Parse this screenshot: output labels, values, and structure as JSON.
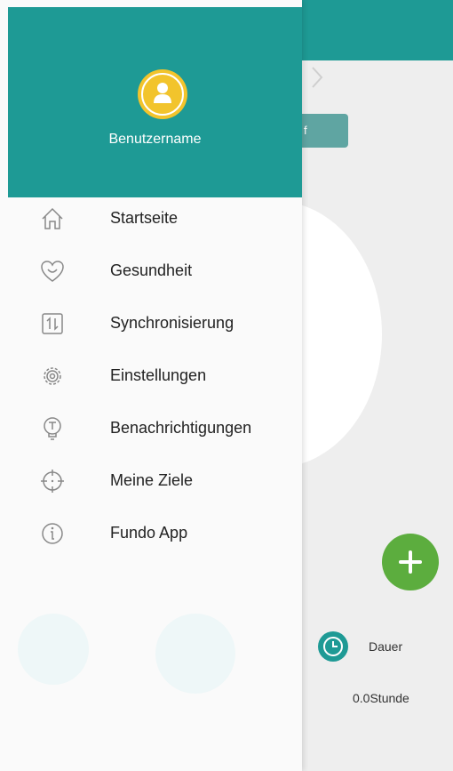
{
  "drawer": {
    "username": "Benutzername",
    "menu": [
      {
        "label": "Startseite",
        "icon": "home-icon"
      },
      {
        "label": "Gesundheit",
        "icon": "heart-smile-icon"
      },
      {
        "label": "Synchronisierung",
        "icon": "sync-icon"
      },
      {
        "label": "Einstellungen",
        "icon": "gear-icon"
      },
      {
        "label": "Benachrichtigungen",
        "icon": "notification-bulb-icon"
      },
      {
        "label": "Meine Ziele",
        "icon": "target-icon"
      },
      {
        "label": "Fundo App",
        "icon": "info-icon"
      }
    ]
  },
  "background": {
    "button_text": "f",
    "dauer_label": "Dauer",
    "dauer_value": "0.0Stunde"
  },
  "colors": {
    "teal": "#1e9a95",
    "green": "#5cad3e",
    "avatar_yellow": "#f2c42c"
  }
}
